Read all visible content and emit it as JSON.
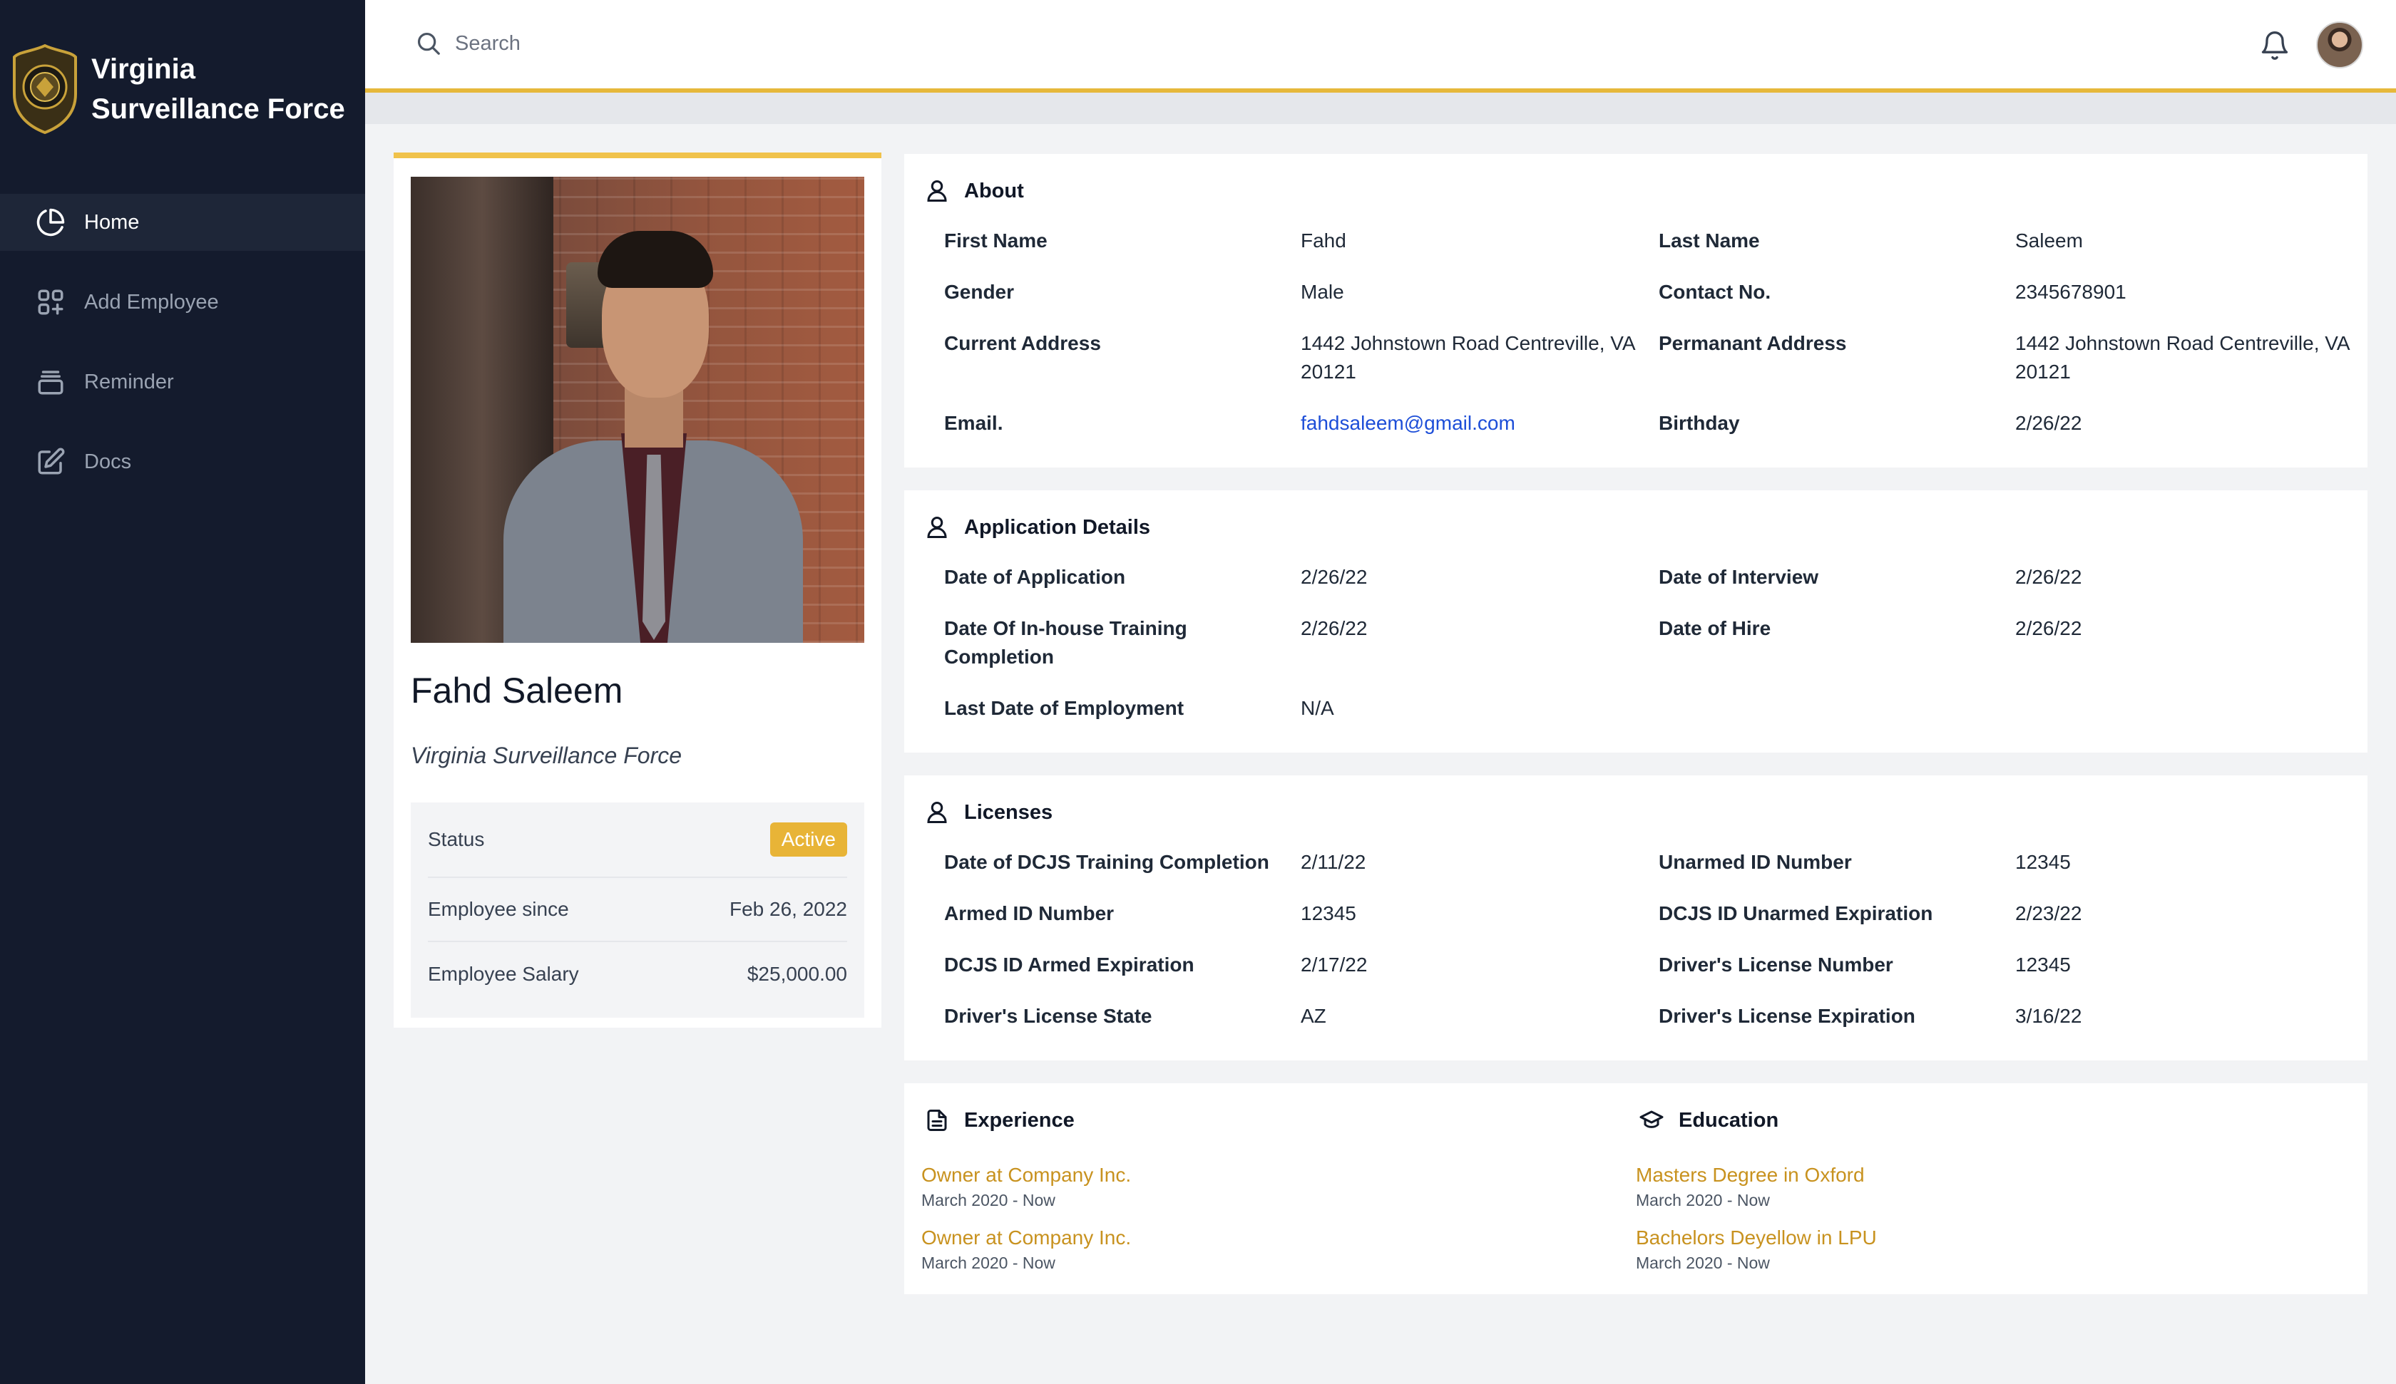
{
  "brand": {
    "name": "Virginia Surveillance Force"
  },
  "nav": [
    {
      "label": "Home",
      "icon": "pie-chart-icon",
      "active": true
    },
    {
      "label": "Add Employee",
      "icon": "add-grid-icon",
      "active": false
    },
    {
      "label": "Reminder",
      "icon": "archive-icon",
      "active": false
    },
    {
      "label": "Docs",
      "icon": "edit-icon",
      "active": false
    }
  ],
  "search": {
    "placeholder": "Search"
  },
  "profile": {
    "name": "Fahd Saleem",
    "organization": "Virginia Surveillance Force",
    "status_label": "Status",
    "status_value": "Active",
    "since_label": "Employee since",
    "since_value": "Feb 26, 2022",
    "salary_label": "Employee Salary",
    "salary_value": "$25,000.00"
  },
  "about": {
    "title": "About",
    "first_name_label": "First Name",
    "first_name": "Fahd",
    "last_name_label": "Last Name",
    "last_name": "Saleem",
    "gender_label": "Gender",
    "gender": "Male",
    "contact_label": "Contact No.",
    "contact": "2345678901",
    "current_address_label": "Current Address",
    "current_address": "1442 Johnstown Road Centreville, VA 20121",
    "permanent_address_label": "Permanant Address",
    "permanent_address": "1442 Johnstown Road Centreville, VA 20121",
    "email_label": "Email.",
    "email": "fahdsaleem@gmail.com",
    "birthday_label": "Birthday",
    "birthday": "2/26/22"
  },
  "application": {
    "title": "Application Details",
    "date_application_label": "Date of Application",
    "date_application": "2/26/22",
    "date_interview_label": "Date of Interview",
    "date_interview": "2/26/22",
    "training_label": "Date Of In-house Training Completion",
    "training": "2/26/22",
    "date_hire_label": "Date of Hire",
    "date_hire": "2/26/22",
    "last_employment_label": "Last Date of Employment",
    "last_employment": "N/A"
  },
  "licenses": {
    "title": "Licenses",
    "dcjs_training_label": "Date of DCJS Training Completion",
    "dcjs_training": "2/11/22",
    "unarmed_id_label": "Unarmed ID Number",
    "unarmed_id": "12345",
    "armed_id_label": "Armed ID Number",
    "armed_id": "12345",
    "unarmed_exp_label": "DCJS ID Unarmed Expiration",
    "unarmed_exp": "2/23/22",
    "armed_exp_label": "DCJS ID Armed Expiration",
    "armed_exp": "2/17/22",
    "dl_number_label": "Driver's License Number",
    "dl_number": "12345",
    "dl_state_label": "Driver's License State",
    "dl_state": "AZ",
    "dl_exp_label": "Driver's License Expiration",
    "dl_exp": "3/16/22"
  },
  "experience": {
    "title": "Experience",
    "items": [
      {
        "title": "Owner at Company Inc.",
        "date": "March 2020 - Now"
      },
      {
        "title": "Owner at Company Inc.",
        "date": "March 2020 - Now"
      }
    ]
  },
  "education": {
    "title": "Education",
    "items": [
      {
        "title": "Masters Degree in Oxford",
        "date": "March 2020 - Now"
      },
      {
        "title": "Bachelors Deyellow in LPU",
        "date": "March 2020 - Now"
      }
    ]
  },
  "colors": {
    "sidebar": "#141b2d",
    "accent": "#e6b83b",
    "link": "#1d4ed8",
    "item_title": "#c8921f"
  }
}
